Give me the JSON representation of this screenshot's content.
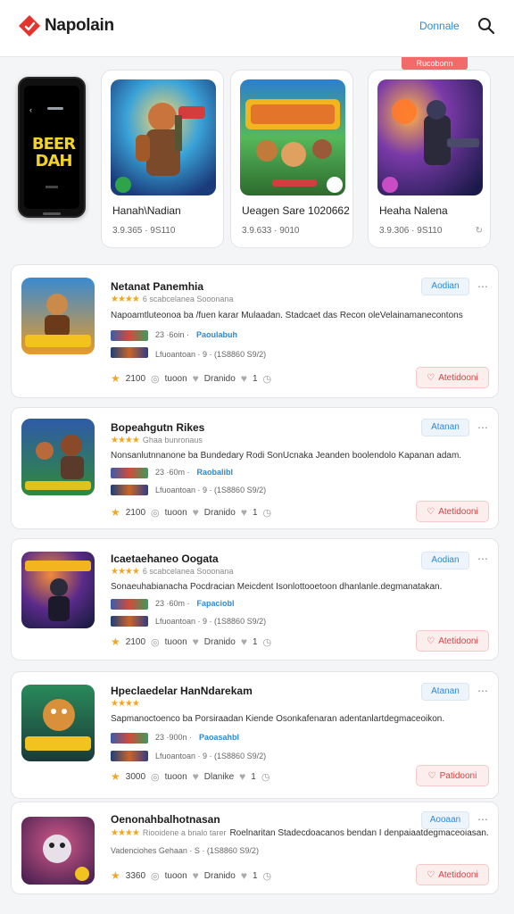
{
  "header": {
    "app_name": "Napolain",
    "link_label": "Donnale",
    "tab_label": "Rucobonn"
  },
  "phone": {
    "title": "BEER DAH"
  },
  "featured": [
    {
      "title": "Hanah\\Nadian",
      "meta": "3.9.365 · 9S110",
      "arrow": ""
    },
    {
      "title": "Ueagen Sare 1020662",
      "meta": "3.9.633 · 9010",
      "arrow": ""
    },
    {
      "title": "Heaha Nalena",
      "meta": "3.9.306 · 9S110",
      "arrow": "⌔"
    }
  ],
  "items": [
    {
      "title": "Netanat Panemhia",
      "rating_text": "6 scabcelanea Sooonana",
      "desc": "Napoamtluteonoa ba /fuen karar Mulaadan. Stadcaet das Recon oleVelainamanecontons",
      "line1_pre": "23 ·6oin ·",
      "line1_tag": "Paoulabuh",
      "line2": "Lfuoantoan · 9 · (1S8860  S9/2)",
      "stat_score": "2100",
      "stat_views": "tuoon",
      "stat_name": "Dranido",
      "stat_likes": "1",
      "action_label": "Aodian",
      "fav_label": "Atetidooni"
    },
    {
      "title": "Bopeahgutn Rikes",
      "rating_text": "Ghaa bunronaus",
      "desc": "Nonsanlutnnanone ba Bundedary Rodi SonUcnaka Jeanden boolendolo Kapanan adam.",
      "line1_pre": "23 ·60m ·",
      "line1_tag": "Raobalibl",
      "line2": "Lfuoantoan · 9 · (1S8860  S9/2)",
      "stat_score": "2100",
      "stat_views": "tuoon",
      "stat_name": "Dranido",
      "stat_likes": "1",
      "action_label": "Atanan",
      "fav_label": "Atetidooni"
    },
    {
      "title": "Icaetaehaneo Oogata",
      "rating_text": "6 scabcelanea Sooonana",
      "desc": "Sonaeuhabianacha Pocdracian Meicdent Isonlottooetoon dhanlanle.degmanatakan.",
      "line1_pre": "23 ·60m ·",
      "line1_tag": "Fapaciobl",
      "line2": "Lfuoantoan · 9 · (1S8860  S9/2)",
      "stat_score": "2100",
      "stat_views": "tuoon",
      "stat_name": "Dranido",
      "stat_likes": "1",
      "action_label": "Aodian",
      "fav_label": "Atetidooni"
    },
    {
      "title": "Hpeclaedelar HanNdarekam",
      "rating_text": "",
      "desc": "Sapmanoctoenco ba Porsiraadan Kiende Osonkafenaran adentanlartdegmaceoikon.",
      "line1_pre": "23 ·900n ·",
      "line1_tag": "Paoasahbl",
      "line2": "Lfuoantoan · 9 · (1S8860  S9/2)",
      "stat_score": "3000",
      "stat_views": "tuoon",
      "stat_name": "Dlanike",
      "stat_likes": "1",
      "action_label": "Atanan",
      "fav_label": "Patidooni"
    },
    {
      "title": "Oenonahbalhotnasan",
      "rating_text": "Riooidene a bnalo tarer",
      "desc": "Roelnaritan Stadecdoacanos bendan I denpaiaatdegmaceoiasan.",
      "line1_pre": "",
      "line1_tag": "",
      "line2": "Vadenciohes Gehaan · S · (1S8860  S9/2)",
      "stat_score": "3360",
      "stat_views": "tuoon",
      "stat_name": "Dranido",
      "stat_likes": "1",
      "action_label": "Aooaan",
      "fav_label": "Atetidooni"
    }
  ]
}
